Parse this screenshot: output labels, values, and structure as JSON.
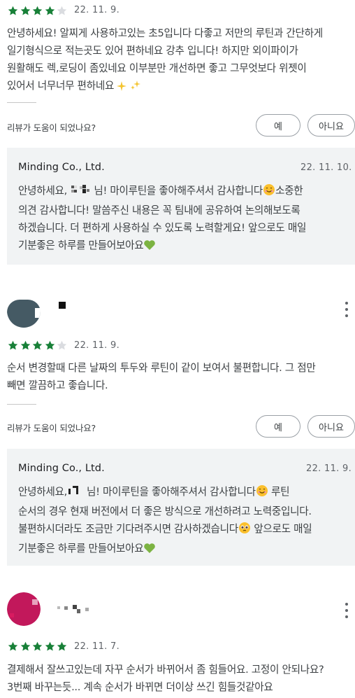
{
  "colors": {
    "star_filled": "#188038",
    "star_empty": "#dadce0",
    "reply_bg": "#f1f3f4",
    "avatar_2": "#455a64",
    "avatar_3": "#c2185b"
  },
  "helpful_prompt": "리뷰가 도움이 되었나요?",
  "yes_label": "예",
  "no_label": "아니요",
  "reviews": [
    {
      "rating": 4,
      "date": "22. 11. 9.",
      "text_lines": [
        "안녕하세요! 알찌게 사용하고있는 초5입니다 다좋고 저만의 루틴과 간단하게",
        "일기형식으로 적는곳도 있어 편하네요 강추 입니다! 하지만 외이파이가",
        "원활해도 렉,로딩이 좀있네요 이부분만 개선하면 좋고 그무엇보다 위젯이",
        "있어서 너무너무 편하네요"
      ],
      "reply": {
        "developer": "Minding Co., Ltd.",
        "date": "22. 11. 10.",
        "line1_a": "안녕하세요,",
        "line1_b": "님! 마이루틴을 좋아해주셔서 감사합니다",
        "line1_c": "소중한",
        "lines": [
          "의견 감사합니다! 말씀주신 내용은 꼭 팀내에 공유하여 논의해보도록",
          "하겠습니다. 더 편하게 사용하실 수 있도록 노력할게요! 앞으로도 매일",
          "기분좋은 하루를 만들어보아요"
        ]
      }
    },
    {
      "rating": 4,
      "date": "22. 11. 9.",
      "text_lines": [
        "순서 변경할때 다른 날짜의 투두와 루틴이 같이 보여서 불편합니다. 그 점만",
        "빼면 깔끔하고 좋습니다."
      ],
      "reply": {
        "developer": "Minding Co., Ltd.",
        "date": "22. 11. 9.",
        "line1_a": "안녕하세요,",
        "line1_b": "님! 마이루틴을 좋아해주셔서 감사합니다",
        "line1_c": "루틴",
        "lines": [
          "순서의 경우 현재 버전에서 더 좋은 방식으로 개선하려고 노력중입니다.",
          "불편하시더라도 조금만 기다려주시면 감사하겠습니다",
          "기분좋은 하루를 만들어보아요"
        ],
        "line3_tail": "앞으로도 매일"
      }
    },
    {
      "rating": 5,
      "date": "22. 11. 7.",
      "text_lines": [
        "결제해서 잘쓰고있는데 자꾸 순서가 바뀌어서 좀 힘들어요. 고정이 안되나요?",
        "3번째 바꾸는듯... 계속 순서가 바뀌면 더이상 쓰긴 힘들것같아요"
      ]
    }
  ]
}
